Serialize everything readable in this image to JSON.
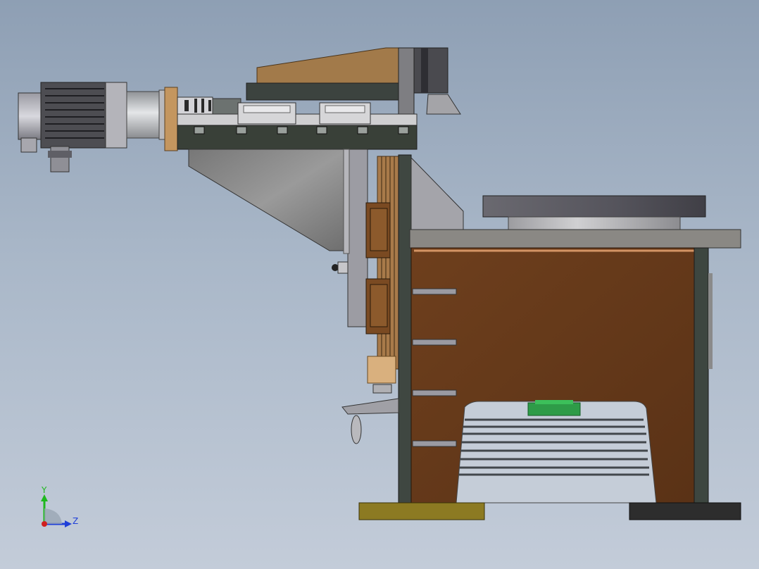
{
  "viewport": {
    "background_top": "#8e9fb4",
    "background_bottom": "#c3ccd9"
  },
  "triad": {
    "y_label": "Y",
    "z_label": "Z",
    "y_color": "#1fb81f",
    "z_color": "#1f3fd8",
    "x_color": "#d01f1f"
  },
  "colors": {
    "cabinet_wood": "#6b3e1c",
    "cabinet_edge": "#c98a55",
    "steel_dark": "#3d4640",
    "table_top": "#8a8884",
    "rotary_disk": "#55545c",
    "gusset": "#8c8c8c",
    "motor": "#4a4a4f",
    "tan_plate": "#a87a4a",
    "foot_left": "#8c7a22",
    "foot_right": "#2d2d2d",
    "green_part": "#2e9b48"
  }
}
